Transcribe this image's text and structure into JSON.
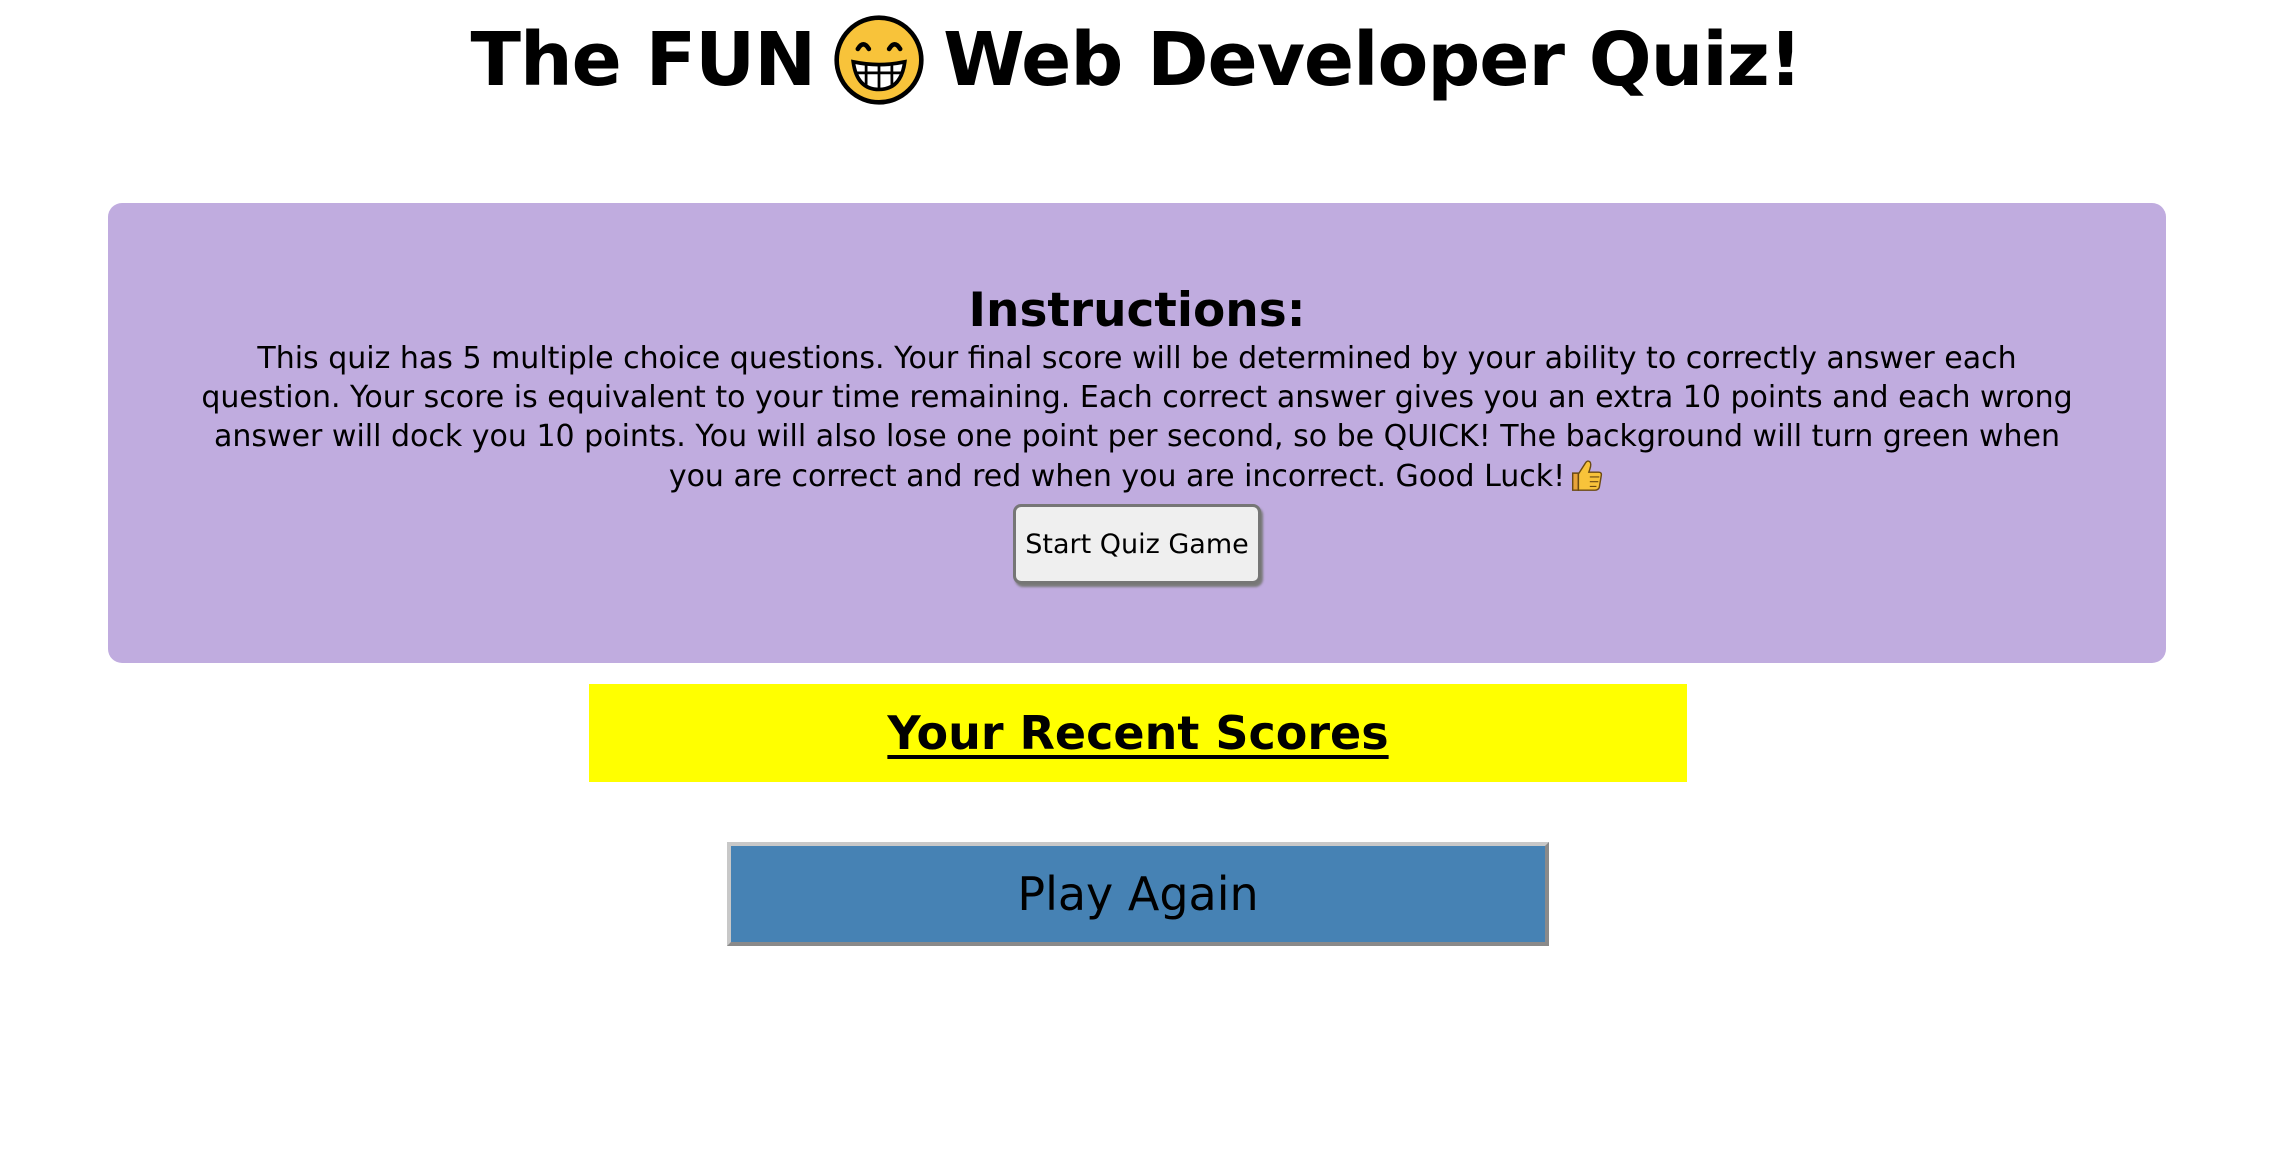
{
  "header": {
    "title_before": "The FUN",
    "title_after": "Web Developer Quiz!",
    "emoji_icon": "grinning-face-icon"
  },
  "instructions": {
    "heading": "Instructions:",
    "body": "This quiz has 5 multiple choice questions. Your final score will be determined by your ability to correctly answer each question. Your score is equivalent to your time remaining. Each correct answer gives you an extra 10 points and each wrong answer will dock you 10 points. You will also lose one point per second, so be QUICK! The background will turn green when you are correct and red when you are incorrect. Good Luck!",
    "trailing_icon": "thumbs-up-icon",
    "start_button_label": "Start Quiz Game",
    "panel_color": "#c0acdf"
  },
  "scores": {
    "title": "Your Recent Scores",
    "banner_color": "#ffff00"
  },
  "play_again": {
    "label": "Play Again",
    "color": "#4682b4"
  }
}
